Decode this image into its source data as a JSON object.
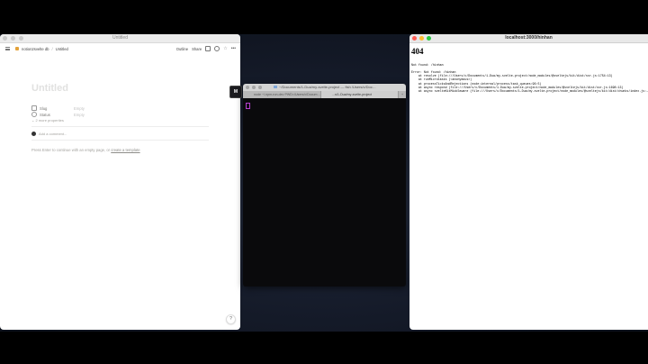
{
  "notion": {
    "window_title": "Untitled",
    "breadcrumb": {
      "workspace": "notion2svelte db",
      "separator": "/",
      "page": "Untitled"
    },
    "toolbar": {
      "outline": "Outline",
      "share": "Share"
    },
    "page": {
      "title": "Untitled",
      "properties": [
        {
          "name": "Slug",
          "value": "Empty"
        },
        {
          "name": "Status",
          "value": "Empty"
        }
      ],
      "more_properties": "2 more properties",
      "comment_placeholder": "Add a comment...",
      "hint_prefix": "Press Enter to continue with an empty page, or",
      "hint_link": "create a template"
    },
    "help": "?"
  },
  "dock": {
    "vscode_label": "M"
  },
  "terminal": {
    "title": "~/Documents/1-Dua/my-svelte-project — fish /Users/c/Doc…",
    "tabs": [
      {
        "label": "node ~/.npm-run-dev PWD=/Users/c/Docum…",
        "active": false
      },
      {
        "label": "…s/1-Dua/my-svelte-project",
        "active": true
      }
    ],
    "add_tab": "+"
  },
  "browser": {
    "title": "localhost:3000/hinhan",
    "heading": "404",
    "not_found": "Not found: /hinhan",
    "stack": "Error: Not found: /hinhan\n    at resolve (file:///Users/c/Documents/1-Dua/my-svelte-project/node_modules/@sveltejs/kit/dist/ssr.js:1754:13)\n    at runMicrotasks (<anonymous>)\n    at processTicksAndRejections (node:internal/process/task_queues:96:5)\n    at async respond (file:///Users/c/Documents/1-Dua/my-svelte-project/node_modules/@sveltejs/kit/dist/ssr.js:1698:13)\n    at async svelteKitMiddleware (file:///Users/c/Documents/1-Dua/my-svelte-project/node_modules/@sveltejs/kit/dist/chunks/index.js:…"
  },
  "colors": {
    "traffic_red": "#ff5f57",
    "traffic_yellow": "#febc2e",
    "traffic_green": "#28c840",
    "cursor": "#b63fd0"
  }
}
